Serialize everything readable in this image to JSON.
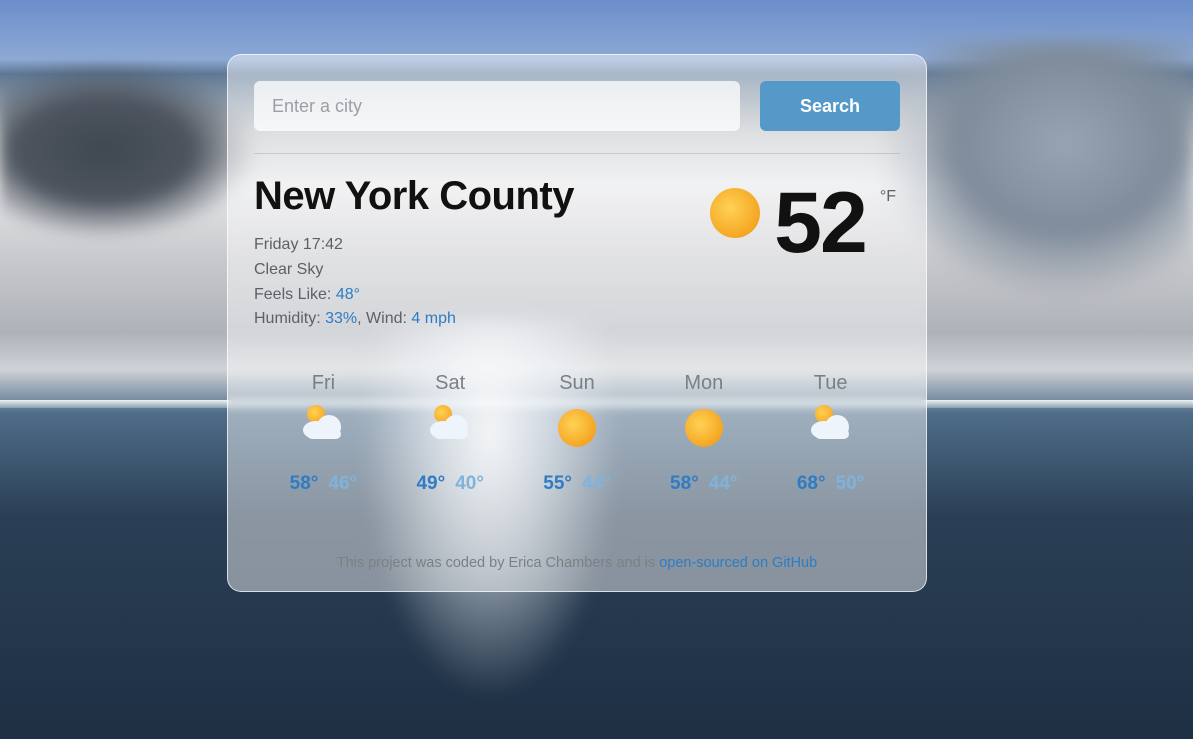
{
  "search": {
    "placeholder": "Enter a city",
    "button": "Search"
  },
  "current": {
    "location": "New York County",
    "datetime": "Friday 17:42",
    "condition": "Clear Sky",
    "feels_like_label": "Feels Like: ",
    "feels_like_value": "48°",
    "humidity_label": "Humidity: ",
    "humidity_value": "33%",
    "wind_label": ", Wind: ",
    "wind_value": "4 mph",
    "temperature": "52",
    "unit": "°F",
    "icon": "sun"
  },
  "forecast": [
    {
      "day": "Fri",
      "icon": "cloud",
      "hi": "58°",
      "lo": "46°"
    },
    {
      "day": "Sat",
      "icon": "cloud",
      "hi": "49°",
      "lo": "40°"
    },
    {
      "day": "Sun",
      "icon": "sun",
      "hi": "55°",
      "lo": "44°"
    },
    {
      "day": "Mon",
      "icon": "sun",
      "hi": "58°",
      "lo": "44°"
    },
    {
      "day": "Tue",
      "icon": "cloud",
      "hi": "68°",
      "lo": "50°"
    }
  ],
  "footer": {
    "text": "This project was coded by Erica Chambers and is ",
    "link_text": "open-sourced on GitHub"
  }
}
